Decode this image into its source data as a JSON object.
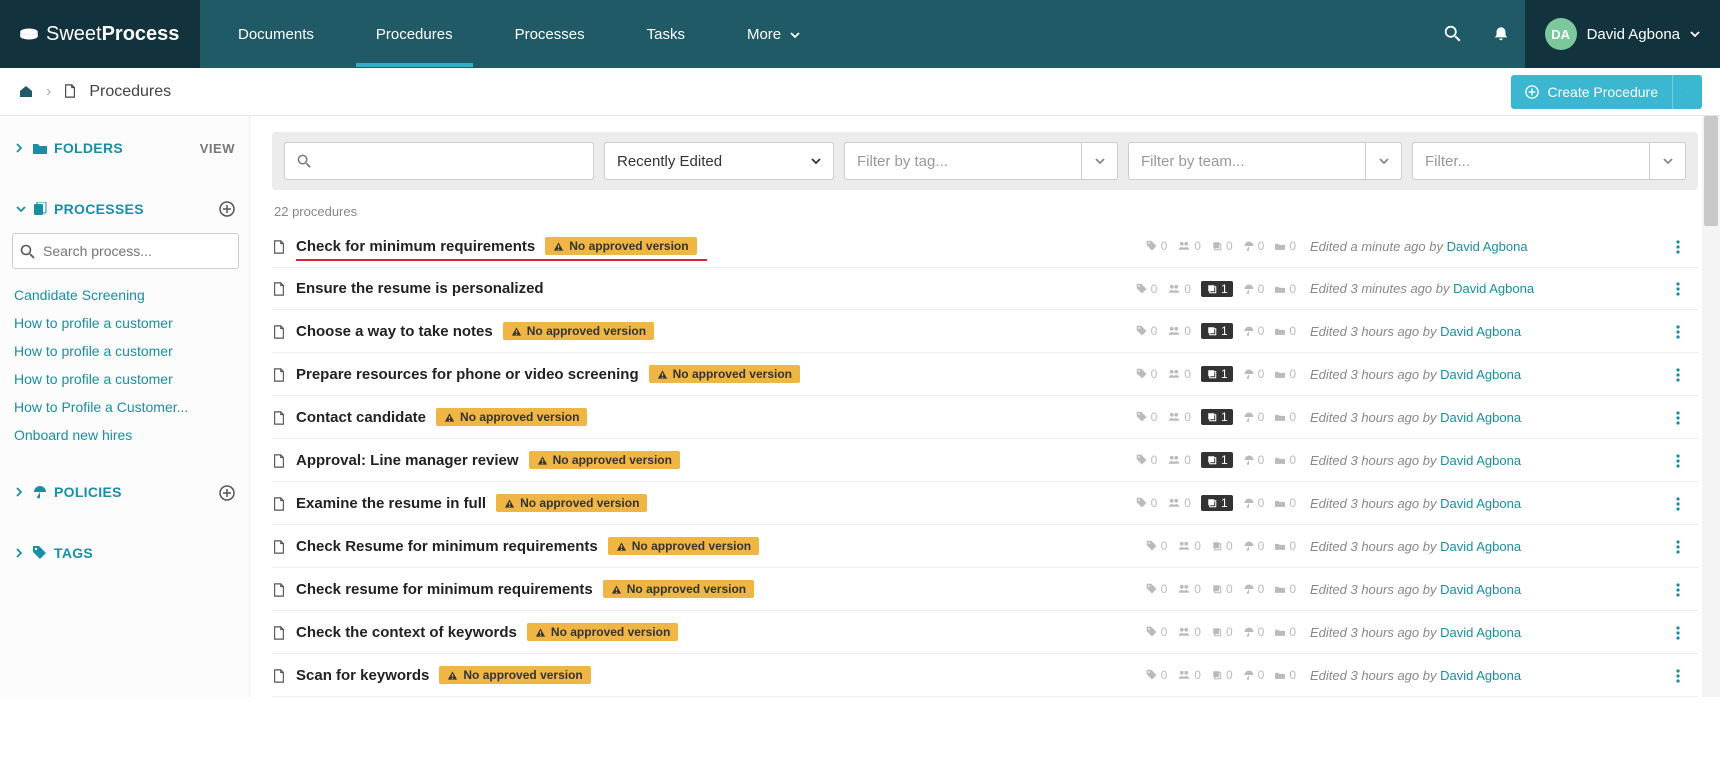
{
  "brand": {
    "thin": "Sweet",
    "bold": "Process"
  },
  "nav": {
    "documents": "Documents",
    "procedures": "Procedures",
    "processes": "Processes",
    "tasks": "Tasks",
    "more": "More"
  },
  "user": {
    "initials": "DA",
    "name": "David Agbona"
  },
  "breadcrumb": {
    "procedures": "Procedures"
  },
  "create_btn": "Create Procedure",
  "sidebar": {
    "folders": "FOLDERS",
    "view": "VIEW",
    "processes": "PROCESSES",
    "search_placeholder": "Search process...",
    "items": [
      "Candidate Screening",
      "How to profile a customer",
      "How to profile a customer",
      "How to profile a customer",
      "How to Profile a Customer...",
      "Onboard new hires"
    ],
    "policies": "POLICIES",
    "tags": "TAGS"
  },
  "filters": {
    "sort": "Recently Edited",
    "tag": "Filter by tag...",
    "team": "Filter by team...",
    "status": "Filter..."
  },
  "count": "22 procedures",
  "badge_text": "No approved version",
  "rows": [
    {
      "title": "Check for minimum requirements",
      "badge": true,
      "highlight": true,
      "stack": 0,
      "edited": "Edited a minute ago by ",
      "editor": "David Agbona"
    },
    {
      "title": "Ensure the resume is personalized",
      "badge": false,
      "stack": 1,
      "edited": "Edited 3 minutes ago by ",
      "editor": "David Agbona"
    },
    {
      "title": "Choose a way to take notes",
      "badge": true,
      "stack": 1,
      "edited": "Edited 3 hours ago by ",
      "editor": "David Agbona"
    },
    {
      "title": "Prepare resources for phone or video screening",
      "badge": true,
      "stack": 1,
      "edited": "Edited 3 hours ago by ",
      "editor": "David Agbona"
    },
    {
      "title": "Contact candidate",
      "badge": true,
      "stack": 1,
      "edited": "Edited 3 hours ago by ",
      "editor": "David Agbona"
    },
    {
      "title": "Approval: Line manager review",
      "badge": true,
      "stack": 1,
      "edited": "Edited 3 hours ago by ",
      "editor": "David Agbona"
    },
    {
      "title": "Examine the resume in full",
      "badge": true,
      "stack": 1,
      "edited": "Edited 3 hours ago by ",
      "editor": "David Agbona"
    },
    {
      "title": "Check Resume for minimum requirements",
      "badge": true,
      "stack": 0,
      "edited": "Edited 3 hours ago by ",
      "editor": "David Agbona"
    },
    {
      "title": "Check resume for minimum requirements",
      "badge": true,
      "stack": 0,
      "edited": "Edited 3 hours ago by ",
      "editor": "David Agbona"
    },
    {
      "title": "Check the context of keywords",
      "badge": true,
      "stack": 0,
      "edited": "Edited 3 hours ago by ",
      "editor": "David Agbona"
    },
    {
      "title": "Scan for keywords",
      "badge": true,
      "stack": 0,
      "edited": "Edited 3 hours ago by ",
      "editor": "David Agbona"
    }
  ]
}
